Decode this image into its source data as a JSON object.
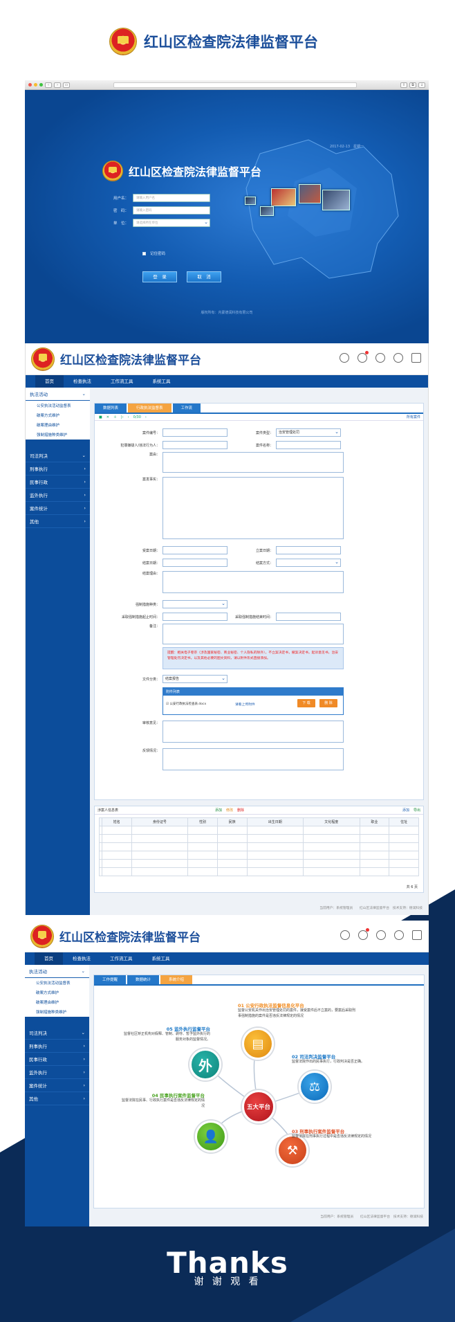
{
  "brand": {
    "title": "红山区检查院法律监督平台"
  },
  "login": {
    "date_text": "2017-02-13　星期一",
    "title": "红山区检查院法律监督平台",
    "username_label": "用户名：",
    "username_placeholder": "请输入用户名",
    "password_label": "密　码：",
    "password_placeholder": "请输入密码",
    "unit_label": "单　位：",
    "unit_placeholder": "请选择所在单位",
    "remember_label": "记住密码",
    "login_button": "登　录",
    "cancel_button": "取　消",
    "copyright": "版权所有：内蒙德润科技有限公司"
  },
  "nav": {
    "items": [
      "首页",
      "检查执法",
      "工作流工具",
      "系统工具"
    ]
  },
  "sidebar": {
    "top": "执法活动",
    "subs": [
      "公安执法活动监督表",
      "破案方式维护",
      "破案理由维护",
      "强制措施种类维护"
    ],
    "groups": [
      "司法判决",
      "刑事执行",
      "民事行政",
      "监外执行",
      "案件统计",
      "其他"
    ]
  },
  "form_page": {
    "tabs": [
      "数据列表",
      "行政执法监督表",
      "工作流"
    ],
    "toolbar_right": "所有案件",
    "pager_text": "0/30",
    "fields": {
      "case_no": "案件编号：",
      "case_type": "案件类型：",
      "case_type_value": "治安管理处罚",
      "person": "犯罪嫌疑人/违法行为人：",
      "case_name": "案件名称：",
      "summary": "案由：",
      "facts": "案发事实：",
      "accept_date": "受案日期：",
      "file_date": "立案日期：",
      "close_date": "结案日期：",
      "close_method": "结案方式：",
      "close_reason": "结案理由：",
      "measure_type": "强制措施种类：",
      "measure_start": "采取强制措施起止时间：",
      "measure_end": "采取强制措施结束时间：",
      "remark": "备注：",
      "notice": "提醒：相关电子卷宗（涉及国家秘密、商业秘密、个人隐私的除外），不立案决定书，撤案决定书，起诉意见书，治安管理处罚决定书，以及其他必要的图文资料，请以附件形式直接添加。",
      "file_class": "文件分类：",
      "file_class_value": "结案报告",
      "attach_title": "附件列表",
      "attach_file": "☑ 公安行政执法检查表.docx",
      "attach_link": "请看上传附件",
      "download": "下 载",
      "delete": "删 除",
      "review": "审核意见：",
      "feedback": "反馈情况："
    },
    "suspects": {
      "title": "涉案人信息表",
      "actions": [
        "添加",
        "修改",
        "删除"
      ],
      "right_actions": [
        "添加",
        "导出"
      ],
      "columns": [
        "",
        "姓名",
        "身份证号",
        "性别",
        "民族",
        "出生日期",
        "文化程度",
        "职业",
        "住址"
      ],
      "pager": "共 6 页"
    },
    "footer": "当前用户：系统管理员　　红山区法律监督平台　技术支持：德润科技"
  },
  "platform_page": {
    "tabs": [
      "工作提醒",
      "数据统计",
      "系统介绍"
    ],
    "center": "五大平台",
    "items": [
      {
        "title": "01 公安行政执法监督信息化平台",
        "desc": "监督公安机关作出治安管理处罚的案件，接受案件后不立案的，要案后采取刑事强制措施的案件是否违反法律规定的情况"
      },
      {
        "title": "02 司法判决监督平台",
        "desc": "监督法院作出的民事执行，行政判决是否正确。"
      },
      {
        "title": "03 刑事执行案件监督平台",
        "desc": "监督法院在刑事执行过程中是否违反法律规定的情况"
      },
      {
        "title": "04 民事执行案件监督平台",
        "desc": "监督法院在民事、行政执行案件是否违反法律规定的情况"
      },
      {
        "title": "05 监外执行监督平台",
        "desc": "监督社区矫正机构对假释、管制、剥夺、暂予监外执行的服务对象的监督情况。"
      }
    ],
    "hub_label_wai": "外",
    "footer": "当前用户：系统管理员　　红山区法律监督平台　技术支持：德润科技"
  },
  "thanks": {
    "big": "Thanks",
    "small": "谢 谢 观 看"
  },
  "colors": {
    "primary": "#0d4f9f",
    "accent": "#f5a441",
    "dark_band": "#0b2b57"
  }
}
